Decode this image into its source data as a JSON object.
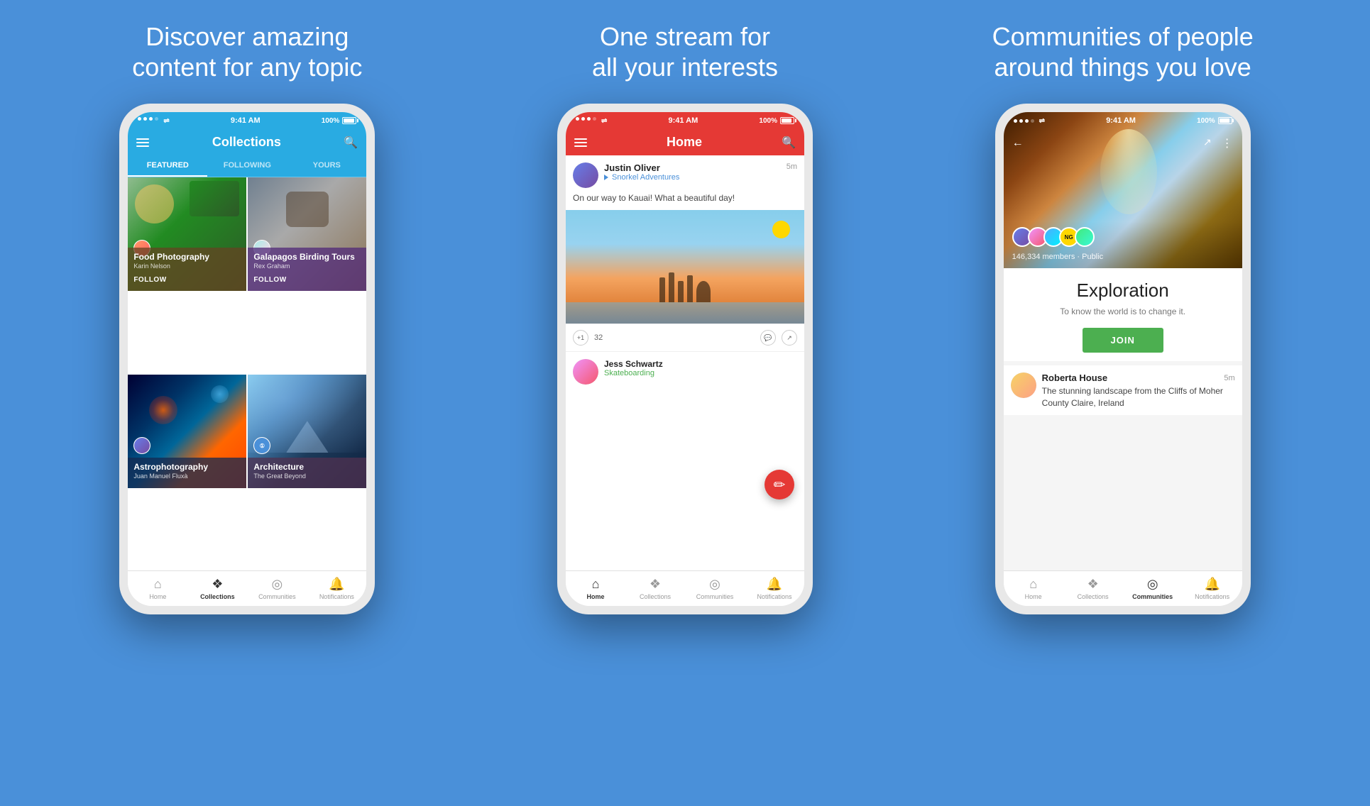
{
  "background_color": "#4A90D9",
  "panels": [
    {
      "title": "Discover amazing\ncontent for any topic",
      "screen": "collections"
    },
    {
      "title": "One stream for\nall your interests",
      "screen": "home"
    },
    {
      "title": "Communities of people\naround things you love",
      "screen": "community"
    }
  ],
  "status_bar": {
    "dots": [
      "active",
      "active",
      "active",
      "inactive"
    ],
    "wifi": true,
    "time": "9:41 AM",
    "battery": "100%"
  },
  "screen1": {
    "header_title": "Collections",
    "tabs": [
      "FEATURED",
      "FOLLOWING",
      "YOURS"
    ],
    "active_tab": "FEATURED",
    "cards": [
      {
        "title": "Food Photography",
        "author": "Karin Nelson",
        "follow_label": "FOLLOW",
        "bg_class": "bg-food"
      },
      {
        "title": "Galapagos Birding Tours",
        "author": "Rex Graham",
        "follow_label": "FOLLOW",
        "bg_class": "bg-bird"
      },
      {
        "title": "Astrophotography",
        "author": "Juan Manuel Fluxà",
        "follow_label": "",
        "bg_class": "bg-nebula"
      },
      {
        "title": "Architecture",
        "author": "The Great Beyond",
        "follow_label": "",
        "bg_class": "bg-arch"
      }
    ],
    "nav": [
      {
        "label": "Home",
        "icon": "⌂",
        "active": false
      },
      {
        "label": "Collections",
        "icon": "❖",
        "active": true
      },
      {
        "label": "Communities",
        "icon": "◎",
        "active": false
      },
      {
        "label": "Notifications",
        "icon": "🔔",
        "active": false
      }
    ]
  },
  "screen2": {
    "header_title": "Home",
    "post1": {
      "author": "Justin Oliver",
      "community": "Snorkel Adventures",
      "time": "5m",
      "text": "On our way to Kauai! What a beautiful day!",
      "plus_count": "+1",
      "comment_count": "32"
    },
    "post2": {
      "author": "Jess Schwartz",
      "community": "Skateboarding",
      "partial_text": "Jess Schwartz ▶ Skateboarding..."
    },
    "nav": [
      {
        "label": "Home",
        "icon": "⌂",
        "active": true
      },
      {
        "label": "Collections",
        "icon": "❖",
        "active": false
      },
      {
        "label": "Communities",
        "icon": "◎",
        "active": false
      },
      {
        "label": "Notifications",
        "icon": "🔔",
        "active": false
      }
    ]
  },
  "screen3": {
    "members_count": "146,334 members · Public",
    "community_name": "Exploration",
    "community_desc": "To know the world is to change it.",
    "join_label": "JOIN",
    "post": {
      "author": "Roberta House",
      "time": "5m",
      "text": "The stunning landscape from the Cliffs of Moher County Claire, Ireland"
    },
    "nav": [
      {
        "label": "Home",
        "icon": "⌂",
        "active": false
      },
      {
        "label": "Collections",
        "icon": "❖",
        "active": false
      },
      {
        "label": "Communities",
        "icon": "◎",
        "active": true
      },
      {
        "label": "Notifications",
        "icon": "🔔",
        "active": false
      }
    ]
  }
}
